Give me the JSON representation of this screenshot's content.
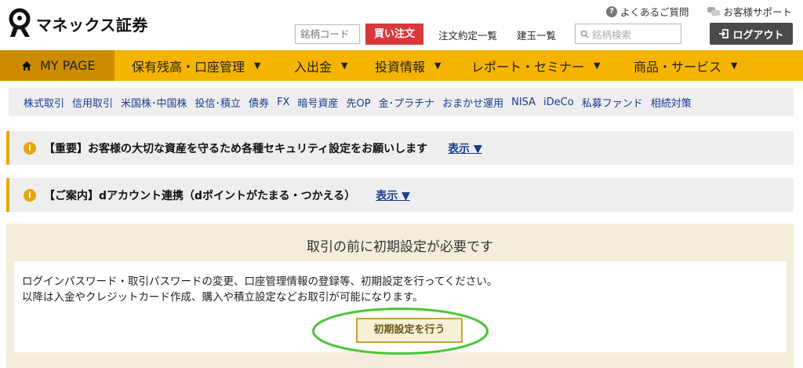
{
  "header": {
    "logo_text": "マネックス証券",
    "faq_label": "よくあるご質問",
    "support_label": "お客様サポート",
    "code_placeholder": "銘柄コード",
    "buy_label": "買い注文",
    "orders_label": "注文約定一覧",
    "positions_label": "建玉一覧",
    "search_placeholder": "銘柄検索",
    "logout_label": "ログアウト"
  },
  "mainnav": {
    "items": [
      {
        "label": "MY PAGE"
      },
      {
        "label": "保有残高・口座管理"
      },
      {
        "label": "入出金"
      },
      {
        "label": "投資情報"
      },
      {
        "label": "レポート・セミナー"
      },
      {
        "label": "商品・サービス"
      }
    ],
    "caret": "▼"
  },
  "subnav": {
    "items": [
      "株式取引",
      "信用取引",
      "米国株･中国株",
      "投信･積立",
      "債券",
      "FX",
      "暗号資産",
      "先OP",
      "金･プラチナ",
      "おまかせ運用",
      "NISA",
      "iDeCo",
      "私募ファンド",
      "相続対策"
    ]
  },
  "notices": [
    {
      "text": "【重要】お客様の大切な資産を守るため各種セキュリティ設定をお願いします",
      "action": "表示 ▼"
    },
    {
      "text": "【ご案内】dアカウント連携（dポイントがたまる・つかえる）",
      "action": "表示 ▼"
    }
  ],
  "setup": {
    "title": "取引の前に初期設定が必要です",
    "line1": "ログインパスワード・取引パスワードの変更、口座管理情報の登録等、初期設定を行ってください。",
    "line2": "以降は入金やクレジットカード作成、購入や積立設定などお取引が可能になります。",
    "button_label": "初期設定を行う"
  },
  "colors": {
    "nav_bg": "#f5b400",
    "nav_active": "#cd8c00",
    "buy_red": "#d9383a",
    "link_blue": "#1a3c8f",
    "highlight_green": "#4cc43a"
  }
}
